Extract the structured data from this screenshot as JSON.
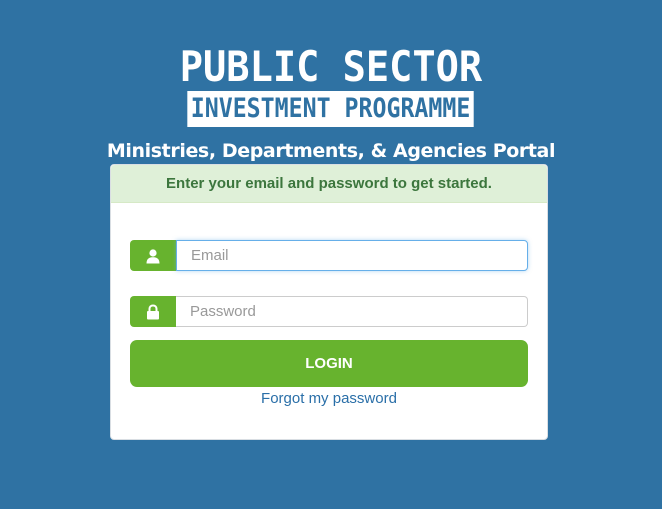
{
  "logo": {
    "line1": "PUBLIC SECTOR",
    "line2": "INVESTMENT PROGRAMME"
  },
  "subtitle": "Ministries, Departments, & Agencies Portal",
  "card": {
    "header": "Enter your email and password to get started."
  },
  "form": {
    "email": {
      "placeholder": "Email",
      "value": "",
      "icon": "user-icon"
    },
    "password": {
      "placeholder": "Password",
      "value": "",
      "icon": "lock-icon"
    },
    "login_label": "LOGIN",
    "forgot_label": "Forgot my password"
  },
  "colors": {
    "background": "#2f72a3",
    "accent_green": "#67b32e",
    "header_bg": "#dff0d8",
    "header_text": "#3c763d",
    "link": "#2a6fa8"
  }
}
